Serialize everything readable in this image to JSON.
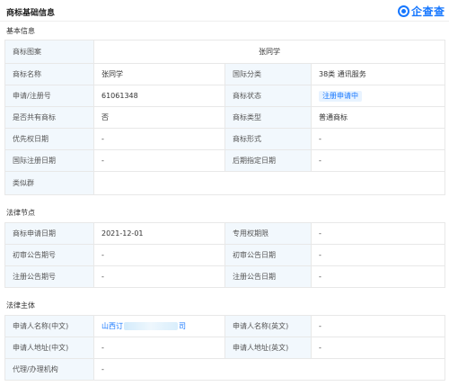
{
  "header": {
    "title": "商标基础信息",
    "logo_text": "企查查",
    "logo_icon": "qichacha-logo-icon"
  },
  "colors": {
    "accent": "#1677ff",
    "label_bg": "#f2f8fd",
    "border": "#e8e8e8",
    "tag_bg": "#e8f3ff"
  },
  "basic": {
    "section_title": "基本信息",
    "image_label": "商标图案",
    "image_value": "张同学",
    "name_label": "商标名称",
    "name_value": "张同学",
    "class_label": "国际分类",
    "class_value": "38类 通讯服务",
    "reg_no_label": "申请/注册号",
    "reg_no_value": "61061348",
    "status_label": "商标状态",
    "status_value": "注册申请中",
    "shared_label": "是否共有商标",
    "shared_value": "否",
    "type_label": "商标类型",
    "type_value": "普通商标",
    "priority_label": "优先权日期",
    "priority_value": "-",
    "form_label": "商标形式",
    "form_value": "-",
    "intl_reg_label": "国际注册日期",
    "intl_reg_value": "-",
    "late_date_label": "后期指定日期",
    "late_date_value": "-",
    "similar_label": "类似群",
    "similar_value": ""
  },
  "legal": {
    "section_title": "法律节点",
    "apply_date_label": "商标申请日期",
    "apply_date_value": "2021-12-01",
    "exclusive_label": "专用权期限",
    "exclusive_value": "-",
    "prelim_no_label": "初审公告期号",
    "prelim_no_value": "-",
    "prelim_date_label": "初审公告日期",
    "prelim_date_value": "-",
    "reg_pub_no_label": "注册公告期号",
    "reg_pub_no_value": "-",
    "reg_pub_date_label": "注册公告日期",
    "reg_pub_date_value": "-"
  },
  "subject": {
    "section_title": "法律主体",
    "applicant_cn_label": "申请人名称(中文)",
    "applicant_cn_prefix": "山西订",
    "applicant_cn_suffix": "司",
    "applicant_en_label": "申请人名称(英文)",
    "applicant_en_value": "-",
    "address_cn_label": "申请人地址(中文)",
    "address_cn_value": "-",
    "address_en_label": "申请人地址(英文)",
    "address_en_value": "-",
    "agent_label": "代理/办理机构",
    "agent_value": "-"
  }
}
